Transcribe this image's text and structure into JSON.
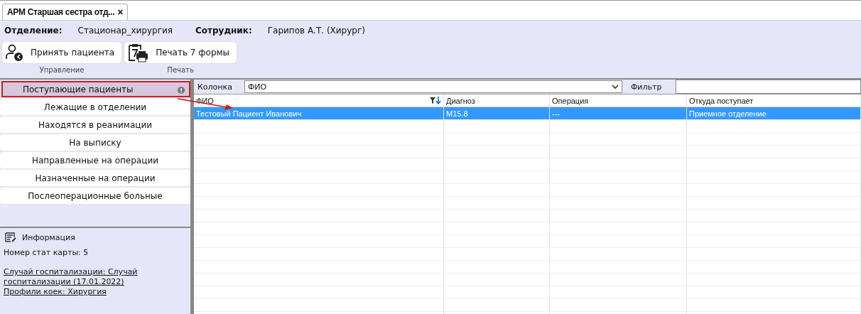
{
  "tabs": [
    {
      "label": "АРМ Старшая сестра отд...",
      "close": "×",
      "selected": true
    }
  ],
  "header": {
    "department_label": "Отделение:",
    "department": "Стационар_хирургия",
    "employee_label": "Сотрудник:",
    "employee": "Гарипов А.Т. (Хирург)"
  },
  "toolbar": {
    "groups": [
      {
        "label": "Управление",
        "buttons": [
          {
            "kind": "accept",
            "label": "Принять пациента"
          }
        ]
      },
      {
        "label": "Печать",
        "buttons": [
          {
            "kind": "print",
            "label": "Печать 7 формы"
          }
        ]
      }
    ]
  },
  "sidebar": {
    "items": [
      {
        "label": "Поступающие пациенты",
        "selected": true,
        "alert": true
      },
      {
        "label": "Лежащие в отделении",
        "selected": false,
        "alert": false
      },
      {
        "label": "Находятся в реанимации",
        "selected": false,
        "alert": false
      },
      {
        "label": "На выписку",
        "selected": false,
        "alert": false
      },
      {
        "label": "Направленные на операции",
        "selected": false,
        "alert": false
      },
      {
        "label": "Назначенные на операции",
        "selected": false,
        "alert": false
      },
      {
        "label": "Послеоперационные больные",
        "selected": false,
        "alert": false
      }
    ]
  },
  "info": {
    "title": "Информация",
    "card_number": "Номер стат карты: 5",
    "links": [
      "Случай госпитализации: Случай госпитализации (17.01.2022)",
      "Профили коек: Хирургия"
    ]
  },
  "filter": {
    "column_label": "Колонка",
    "column_value": "ФИО",
    "filter_label": "Фильтр"
  },
  "table": {
    "columns": [
      {
        "label": "ФИО",
        "filtered": true
      },
      {
        "label": "Диагноз",
        "filtered": false
      },
      {
        "label": "Операция",
        "filtered": false
      },
      {
        "label": "Откуда поступает",
        "filtered": false
      }
    ],
    "rows": [
      {
        "cells": [
          "Тестовый Пациент Иванович",
          "M15.8",
          "---",
          "Приемное отделение"
        ],
        "selected": true
      }
    ]
  }
}
